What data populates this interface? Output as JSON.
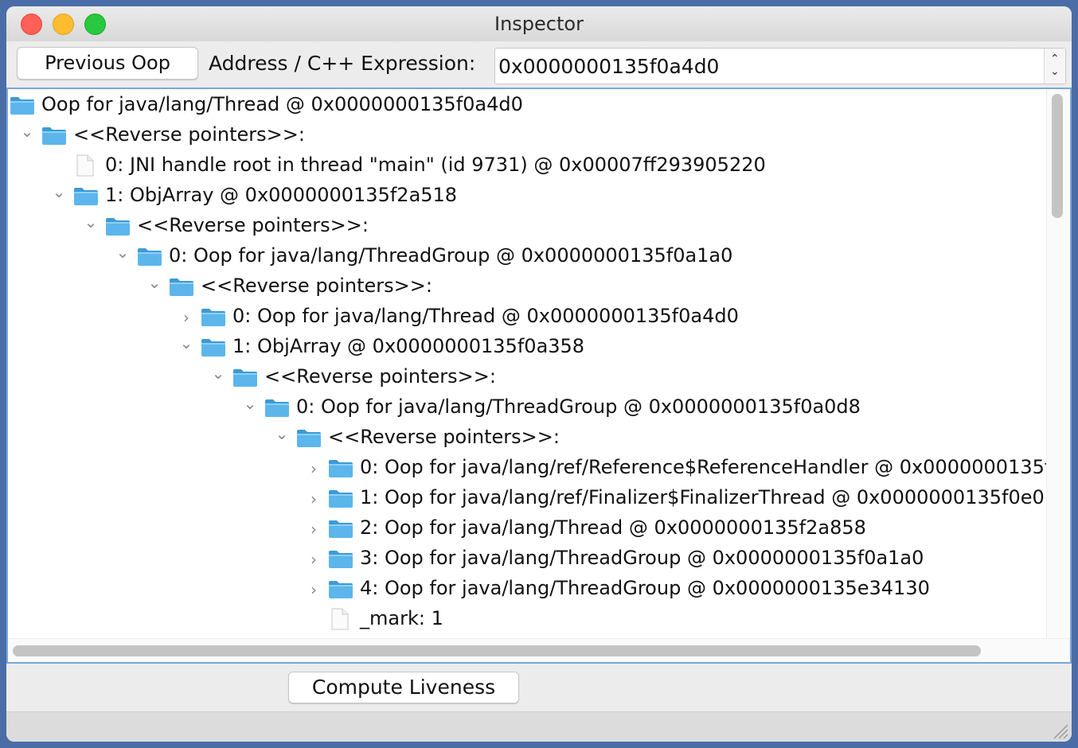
{
  "window": {
    "title": "Inspector"
  },
  "toolbar": {
    "previous_button": "Previous Oop",
    "address_label": "Address / C++ Expression:",
    "address_value": "0x0000000135f0a4d0"
  },
  "tree": [
    {
      "depth": 0,
      "expander": "none",
      "icon": "folder",
      "label": "Oop for java/lang/Thread @ 0x0000000135f0a4d0"
    },
    {
      "depth": 1,
      "expander": "expanded",
      "icon": "folder",
      "label": "<<Reverse pointers>>:"
    },
    {
      "depth": 2,
      "expander": "none",
      "icon": "document",
      "label": "0: JNI handle root in thread \"main\" (id 9731) @ 0x00007ff293905220"
    },
    {
      "depth": 2,
      "expander": "expanded",
      "icon": "folder",
      "label": "1: ObjArray @ 0x0000000135f2a518"
    },
    {
      "depth": 3,
      "expander": "expanded",
      "icon": "folder",
      "label": "<<Reverse pointers>>:"
    },
    {
      "depth": 4,
      "expander": "expanded",
      "icon": "folder",
      "label": "0: Oop for java/lang/ThreadGroup @ 0x0000000135f0a1a0"
    },
    {
      "depth": 5,
      "expander": "expanded",
      "icon": "folder",
      "label": "<<Reverse pointers>>:"
    },
    {
      "depth": 6,
      "expander": "collapsed",
      "icon": "folder",
      "label": "0: Oop for java/lang/Thread @ 0x0000000135f0a4d0"
    },
    {
      "depth": 6,
      "expander": "expanded",
      "icon": "folder",
      "label": "1: ObjArray @ 0x0000000135f0a358"
    },
    {
      "depth": 7,
      "expander": "expanded",
      "icon": "folder",
      "label": "<<Reverse pointers>>:"
    },
    {
      "depth": 8,
      "expander": "expanded",
      "icon": "folder",
      "label": "0: Oop for java/lang/ThreadGroup @ 0x0000000135f0a0d8"
    },
    {
      "depth": 9,
      "expander": "expanded",
      "icon": "folder",
      "label": "<<Reverse pointers>>:"
    },
    {
      "depth": 10,
      "expander": "collapsed",
      "icon": "folder",
      "label": "0: Oop for java/lang/ref/Reference$ReferenceHandler @ 0x0000000135f"
    },
    {
      "depth": 10,
      "expander": "collapsed",
      "icon": "folder",
      "label": "1: Oop for java/lang/ref/Finalizer$FinalizerThread @ 0x0000000135f0e0"
    },
    {
      "depth": 10,
      "expander": "collapsed",
      "icon": "folder",
      "label": "2: Oop for java/lang/Thread @ 0x0000000135f2a858"
    },
    {
      "depth": 10,
      "expander": "collapsed",
      "icon": "folder",
      "label": "3: Oop for java/lang/ThreadGroup @ 0x0000000135f0a1a0"
    },
    {
      "depth": 10,
      "expander": "collapsed",
      "icon": "folder",
      "label": "4: Oop for java/lang/ThreadGroup @ 0x0000000135e34130"
    },
    {
      "depth": 10,
      "expander": "none",
      "icon": "document",
      "label": "_mark: 1"
    }
  ],
  "bottom": {
    "compute_button": "Compute Liveness"
  },
  "colors": {
    "folder": "#5cb6ec",
    "folder_dark": "#3d9ad6",
    "focus_border": "#7aa7d6"
  }
}
